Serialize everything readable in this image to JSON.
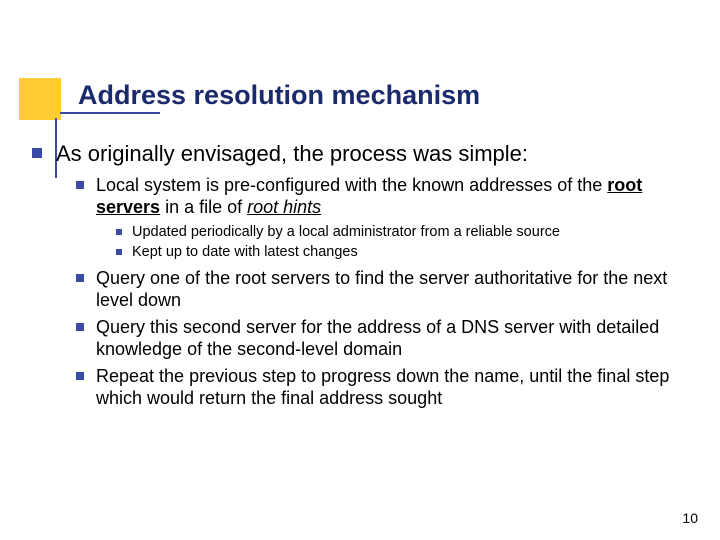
{
  "title": "Address resolution mechanism",
  "lvl1_text": "As originally envisaged, the process was simple:",
  "lvl2": {
    "a_pre": "Local system is pre-configured with the known addresses of the ",
    "a_bold": "root servers",
    "a_mid": " in a file of ",
    "a_ital": "root hints",
    "b": "Query one of the root servers to find the server authoritative for the next level down",
    "c": "Query this second server for the address of a DNS server with detailed knowledge of the second-level domain",
    "d": "Repeat the previous step to progress down the name, until the final step which would return the final address sought"
  },
  "lvl3": {
    "a": "Updated periodically by a local administrator from a reliable source",
    "b": "Kept up to date with latest changes"
  },
  "page_number": "10"
}
